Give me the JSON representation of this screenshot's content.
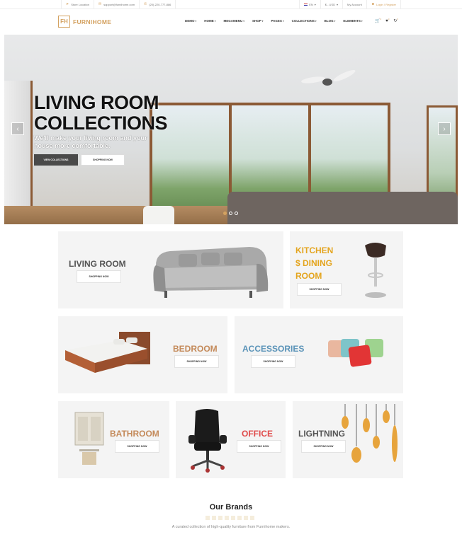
{
  "topbar": {
    "store_location": "Store Location",
    "email": "support@furnihome.com",
    "phone": "(20)-220-777-886",
    "language": "EN",
    "currency": "$ - USD",
    "my_account": "My Account",
    "login": "Login / Register"
  },
  "header": {
    "logo_mark": "FH",
    "logo_text": "FURNIHOME",
    "nav": [
      "DEMO",
      "HOME",
      "MEGAMENU",
      "SHOP",
      "PAGES",
      "COLLECTIONS",
      "BLOG",
      "ELEMENTS"
    ],
    "cart_count": "0",
    "wishlist_count": "0",
    "compare_count": "0"
  },
  "hero": {
    "title_line1": "LIVING ROOM",
    "title_line2": "COLLECTIONS",
    "subtitle": "We'll make your living room and your house more comfortable.",
    "btn_primary": "VIEW COLLECTIONS",
    "btn_secondary": "SHOPPING NOW",
    "prev_icon": "chevron-left-icon",
    "next_icon": "chevron-right-icon",
    "slides": 3,
    "active_slide": 1
  },
  "categories": [
    {
      "title": "LIVING ROOM",
      "button": "SHOPPING NOW",
      "color": "#555555"
    },
    {
      "title_lines": [
        "KITCHEN",
        "$ DINING",
        "ROOM"
      ],
      "button": "SHOPPING NOW",
      "color": "#e4a51f"
    },
    {
      "title": "BEDROOM",
      "button": "SHOPPING NOW",
      "color": "#c48a5a"
    },
    {
      "title": "ACCESSORIES",
      "button": "SHOPPING NOW",
      "color": "#5a93b8"
    },
    {
      "title": "BATHROOM",
      "button": "SHOPPING NOW",
      "color": "#c48a5a"
    },
    {
      "title": "OFFICE",
      "button": "SHOPPING NOW",
      "color": "#e04b4b"
    },
    {
      "title": "LIGHTNING",
      "button": "SHOPPING NOW",
      "color": "#555555"
    }
  ],
  "brands": {
    "title": "Our Brands",
    "subtitle": "A curated collection of high-quality furniture from Furnihome makers."
  }
}
